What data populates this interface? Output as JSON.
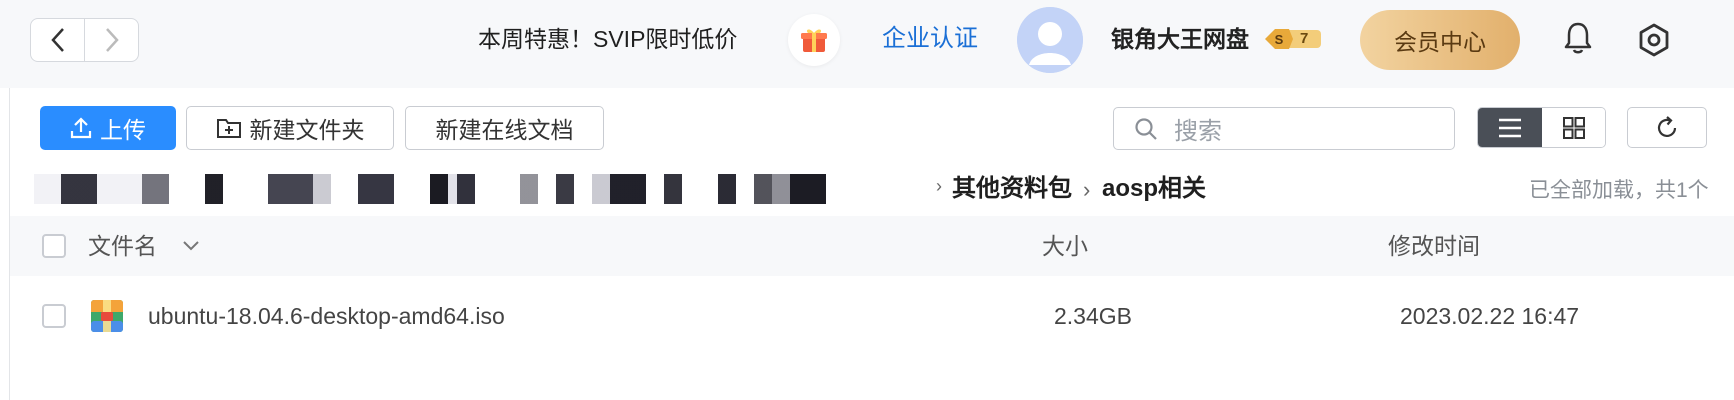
{
  "header": {
    "promo_text": "本周特惠！SVIP限时低价",
    "verify_label": "企业认证",
    "username": "银角大王网盘",
    "vip_badge_letter": "S",
    "vip_level": "7",
    "member_center_label": "会员中心"
  },
  "toolbar": {
    "upload_label": "上传",
    "new_folder_label": "新建文件夹",
    "new_doc_label": "新建在线文档",
    "search_placeholder": "搜索"
  },
  "breadcrumb": {
    "items": [
      "其他资料包",
      "aosp相关"
    ],
    "load_status": "已全部加载，共1个"
  },
  "table": {
    "columns": [
      "文件名",
      "大小",
      "修改时间"
    ],
    "rows": [
      {
        "name": "ubuntu-18.04.6-desktop-amd64.iso",
        "size": "2.34GB",
        "modified": "2023.02.22 16:47"
      }
    ]
  },
  "colors": {
    "accent": "#2a8dff",
    "link": "#1a6fd6",
    "member_gold": "#e2b06c"
  }
}
